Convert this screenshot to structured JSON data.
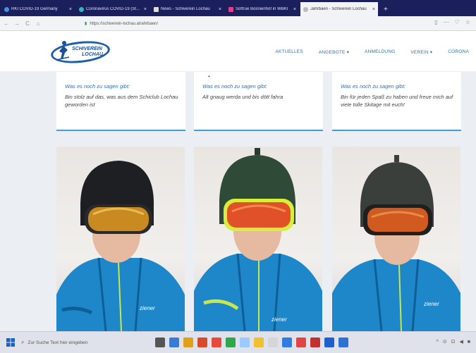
{
  "browser": {
    "tabs": [
      {
        "label": "RKI COVID-19 Germany",
        "color": "#4a90d9",
        "active": false
      },
      {
        "label": "Coronavirus COVID-19 (Statis…",
        "color": "#34b3c8",
        "active": false
      },
      {
        "label": "News - Schiverein Lochau",
        "color": "#dddddd",
        "active": false
      },
      {
        "label": "Softrue Bosnienhof in WBKI",
        "color": "#e0408a",
        "active": false
      },
      {
        "label": "Jahrbaen - Schiverein Lochau",
        "color": "#e9e9e9",
        "active": true
      }
    ],
    "tab_close": "×",
    "new_tab": "+",
    "url": "https://schiverein-lochau.at/ahrbaen/",
    "nav_glyphs": {
      "back": "←",
      "forward": "→",
      "reload": "C",
      "home": "⌂"
    },
    "right_glyphs": {
      "reader": "▯",
      "more": "⋯",
      "shield": "♡",
      "star": "☆"
    }
  },
  "site": {
    "logo_text_line1": "SCHIVEREIN",
    "logo_text_line2": "LOCHAU",
    "nav": [
      "AKTUELLES",
      "ANGEBOTE ▾",
      "ANMELDUNG",
      "VEREIN ▾",
      "CORONA"
    ]
  },
  "cards": [
    {
      "question": "Was es noch zu sagen gibt:",
      "answer": "Bin stolz auf das, was aus dem Schiclub Lochau geworden ist"
    },
    {
      "question": "Was es noch zu sagen gibt:",
      "answer": "Alt gnaug werda und bis dött fahra"
    },
    {
      "question": "Was es noch zu sagen gibt:",
      "answer": "Bin für jeden Spaß zu haben und freue mich auf viele tolle Skitage mit euch!"
    }
  ],
  "photos": [
    {
      "helmet": "#1e1f22",
      "goggle": "#c98a22",
      "strap": "#2a2a2a"
    },
    {
      "helmet": "#2f4a36",
      "goggle": "#e0512a",
      "strap": "#d7ef3a"
    },
    {
      "helmet": "#3a3f3c",
      "goggle": "#d05a1f",
      "strap": "#1f1f1f"
    }
  ],
  "jacket_color": "#1d87c9",
  "jacket_logo": "ziener",
  "taskbar": {
    "search_placeholder": "Zur Suche Text hier eingeben",
    "tray": "^ ⊙ ⊡ ◀ ■"
  },
  "taskbar_icon_colors": [
    "#555555",
    "#3b7bd4",
    "#e0a01a",
    "#d84a2a",
    "#e84a3a",
    "#2ea84a",
    "#9cc9ff",
    "#f0c030",
    "#d6d6d6",
    "#2f7de1",
    "#e04545",
    "#c23030",
    "#1e5fd0",
    "#2e6fd8"
  ]
}
